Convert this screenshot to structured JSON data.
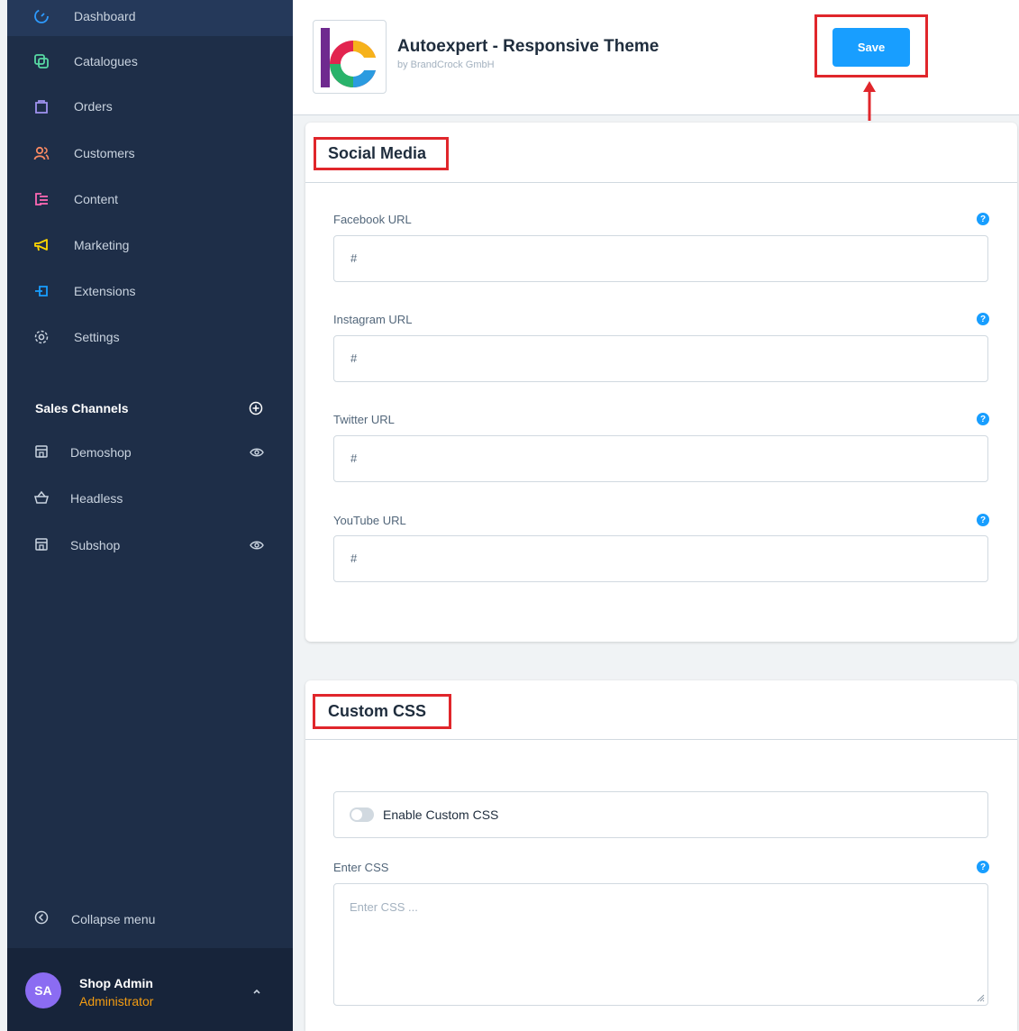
{
  "sidebar": {
    "nav": [
      {
        "label": "Dashboard",
        "icon": "dashboard-icon",
        "color": "#2e9bff"
      },
      {
        "label": "Catalogues",
        "icon": "catalogues-icon",
        "color": "#57d9a3"
      },
      {
        "label": "Orders",
        "icon": "orders-icon",
        "color": "#a092f0"
      },
      {
        "label": "Customers",
        "icon": "customers-icon",
        "color": "#f88962"
      },
      {
        "label": "Content",
        "icon": "content-icon",
        "color": "#ff68b4"
      },
      {
        "label": "Marketing",
        "icon": "marketing-icon",
        "color": "#ffd700"
      },
      {
        "label": "Extensions",
        "icon": "extensions-icon",
        "color": "#189eff"
      },
      {
        "label": "Settings",
        "icon": "settings-icon",
        "color": "#9aa8b5"
      }
    ],
    "sales_channels_title": "Sales Channels",
    "channels": [
      {
        "label": "Demoshop",
        "icon": "storefront-icon"
      },
      {
        "label": "Headless",
        "icon": "basket-icon"
      },
      {
        "label": "Subshop",
        "icon": "storefront-icon"
      }
    ],
    "collapse_label": "Collapse menu",
    "user": {
      "initials": "SA",
      "name": "Shop Admin",
      "role": "Administrator"
    }
  },
  "header": {
    "title": "Autoexpert - Responsive Theme",
    "vendor": "by BrandCrock GmbH",
    "save_label": "Save"
  },
  "social": {
    "title": "Social Media",
    "fields": [
      {
        "label": "Facebook URL",
        "value": "#"
      },
      {
        "label": "Instagram URL",
        "value": "#"
      },
      {
        "label": "Twitter URL",
        "value": "#"
      },
      {
        "label": "YouTube URL",
        "value": "#"
      }
    ]
  },
  "css": {
    "title": "Custom CSS",
    "toggle_label": "Enable Custom CSS",
    "toggle_on": false,
    "textarea_label": "Enter CSS",
    "textarea_placeholder": "Enter CSS ..."
  },
  "colors": {
    "accent": "#189eff",
    "highlight": "#e0262b",
    "sidebar": "#1e2e48"
  }
}
